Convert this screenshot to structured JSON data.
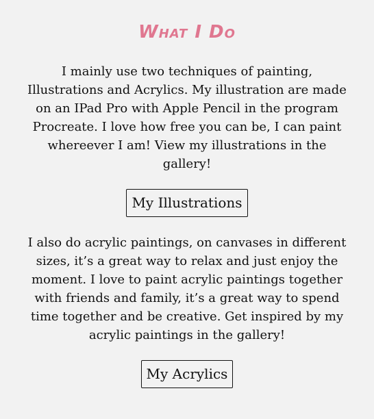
{
  "section": {
    "title": "What I Do",
    "paragraph_1": "I mainly use two techniques of painting, Illustrations and Acrylics. My illustration are made on an IPad Pro with Apple Pencil in the program Procreate. I love how free you can be, I can paint whereever I am! View my illustrations in the gallery!",
    "button_1": "My Illustrations",
    "paragraph_2": "I also do acrylic paintings, on canvases in different sizes, it’s a great way to relax and just enjoy the moment. I love to paint acrylic paintings together with friends and family, it’s a great way to spend time together and be creative. Get inspired by my acrylic paintings in the gallery!",
    "button_2": "My Acrylics"
  },
  "colors": {
    "background": "#f2f2f2",
    "title": "#e07790",
    "text": "#111111"
  }
}
